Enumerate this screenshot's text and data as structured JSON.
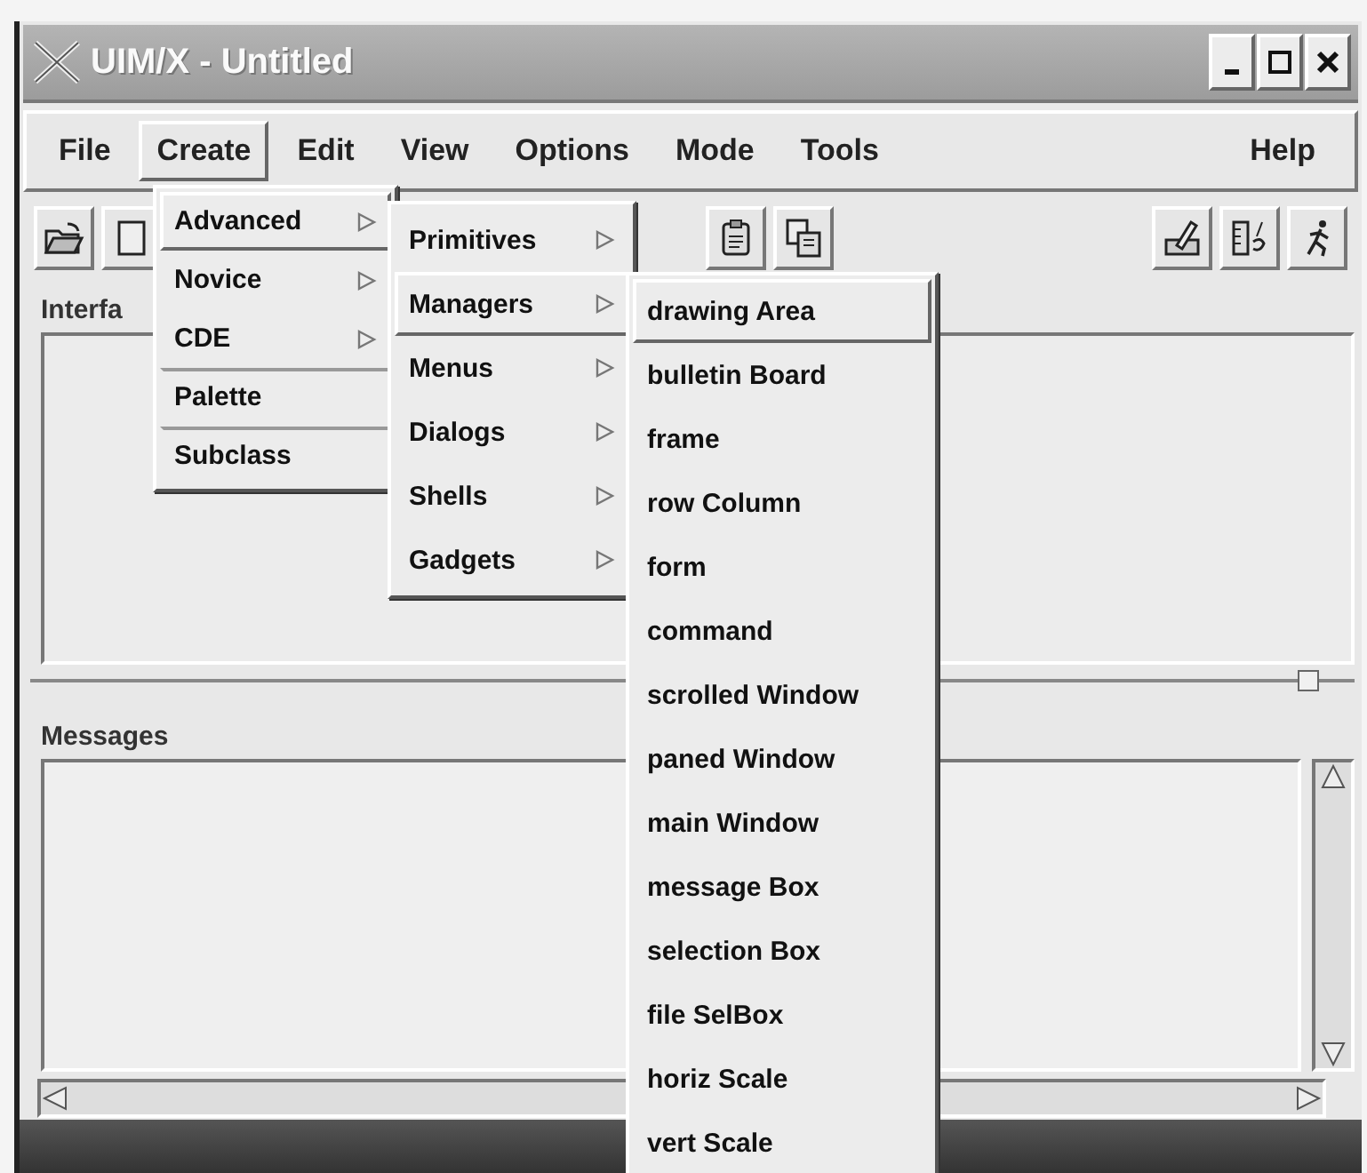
{
  "window": {
    "title": "UIM/X - Untitled"
  },
  "menubar": [
    {
      "label": "File",
      "selected": false,
      "kind": "left"
    },
    {
      "label": "Create",
      "selected": true,
      "kind": "left"
    },
    {
      "label": "Edit",
      "selected": false,
      "kind": "left"
    },
    {
      "label": "View",
      "selected": false,
      "kind": "left"
    },
    {
      "label": "Options",
      "selected": false,
      "kind": "left"
    },
    {
      "label": "Mode",
      "selected": false,
      "kind": "left"
    },
    {
      "label": "Tools",
      "selected": false,
      "kind": "left"
    },
    {
      "label": "Help",
      "selected": false,
      "kind": "right"
    }
  ],
  "interface_panel": {
    "label": "Interfa"
  },
  "messages_panel": {
    "label": "Messages"
  },
  "menus": [
    {
      "items": [
        {
          "label": "Advanced",
          "submenu": true,
          "selected": true,
          "separator_before": false
        },
        {
          "label": "Novice",
          "submenu": true,
          "selected": false,
          "separator_before": false
        },
        {
          "label": "CDE",
          "submenu": true,
          "selected": false,
          "separator_before": false
        },
        {
          "label": "Palette",
          "submenu": false,
          "selected": false,
          "separator_before": true
        },
        {
          "label": "Subclass",
          "submenu": false,
          "selected": false,
          "separator_before": true
        }
      ]
    },
    {
      "items": [
        {
          "label": "Primitives",
          "submenu": true,
          "selected": false,
          "separator_before": false
        },
        {
          "label": "Managers",
          "submenu": true,
          "selected": true,
          "separator_before": false
        },
        {
          "label": "Menus",
          "submenu": true,
          "selected": false,
          "separator_before": false
        },
        {
          "label": "Dialogs",
          "submenu": true,
          "selected": false,
          "separator_before": false
        },
        {
          "label": "Shells",
          "submenu": true,
          "selected": false,
          "separator_before": false
        },
        {
          "label": "Gadgets",
          "submenu": true,
          "selected": false,
          "separator_before": false
        }
      ]
    },
    {
      "items": [
        {
          "label": "drawing Area",
          "submenu": false,
          "selected": true,
          "separator_before": false
        },
        {
          "label": "bulletin Board",
          "submenu": false,
          "selected": false,
          "separator_before": false
        },
        {
          "label": "frame",
          "submenu": false,
          "selected": false,
          "separator_before": false
        },
        {
          "label": "row Column",
          "submenu": false,
          "selected": false,
          "separator_before": false
        },
        {
          "label": "form",
          "submenu": false,
          "selected": false,
          "separator_before": false
        },
        {
          "label": "command",
          "submenu": false,
          "selected": false,
          "separator_before": false
        },
        {
          "label": "scrolled Window",
          "submenu": false,
          "selected": false,
          "separator_before": false
        },
        {
          "label": "paned Window",
          "submenu": false,
          "selected": false,
          "separator_before": false
        },
        {
          "label": "main Window",
          "submenu": false,
          "selected": false,
          "separator_before": false
        },
        {
          "label": "message Box",
          "submenu": false,
          "selected": false,
          "separator_before": false
        },
        {
          "label": "selection Box",
          "submenu": false,
          "selected": false,
          "separator_before": false
        },
        {
          "label": "file SelBox",
          "submenu": false,
          "selected": false,
          "separator_before": false
        },
        {
          "label": "horiz Scale",
          "submenu": false,
          "selected": false,
          "separator_before": false
        },
        {
          "label": "vert Scale",
          "submenu": false,
          "selected": false,
          "separator_before": false
        }
      ]
    }
  ]
}
